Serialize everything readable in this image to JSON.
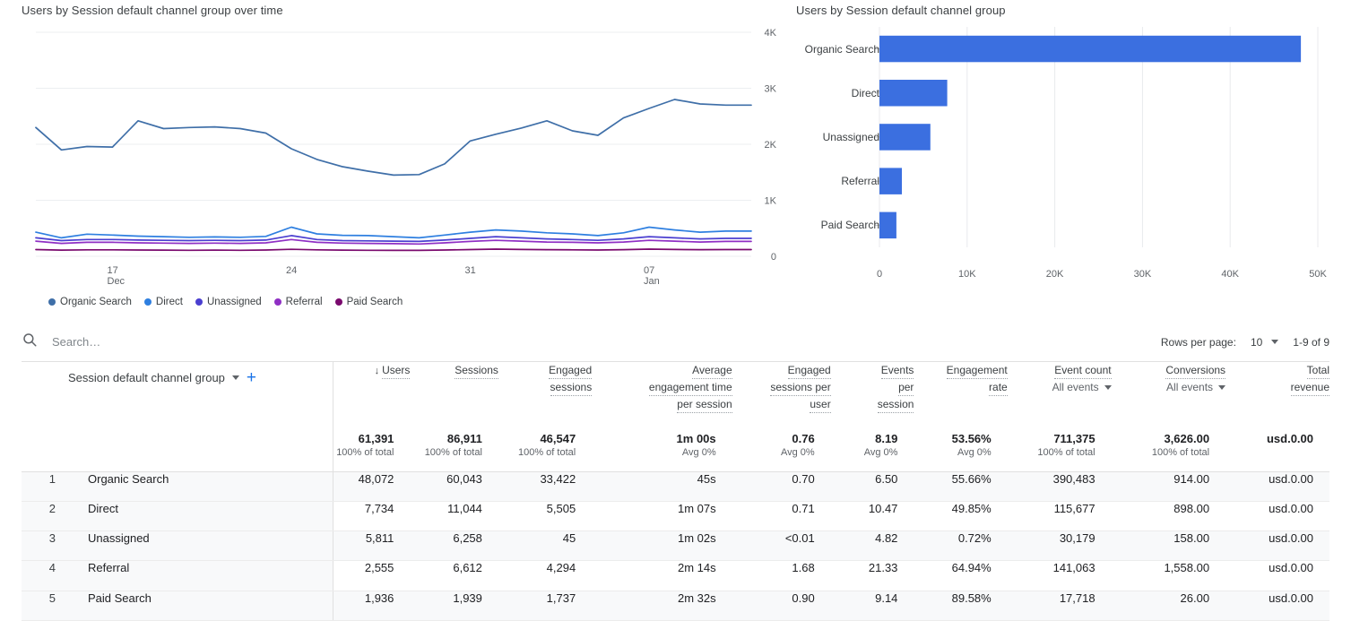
{
  "line_card": {
    "title": "Users by Session default channel group over time",
    "legend": [
      {
        "label": "Organic Search",
        "color": "#3f6fa8"
      },
      {
        "label": "Direct",
        "color": "#2e7fe0"
      },
      {
        "label": "Unassigned",
        "color": "#4b3fd0"
      },
      {
        "label": "Referral",
        "color": "#8f2fc4"
      },
      {
        "label": "Paid Search",
        "color": "#7a0a6e"
      }
    ]
  },
  "bar_card": {
    "title": "Users by Session default channel group"
  },
  "toolbar": {
    "search_placeholder": "Search…",
    "search_value": "",
    "search_icon": "search-icon",
    "rows_per_page_label": "Rows per page:",
    "rows_per_page_value": "10",
    "range_label": "1-9 of 9"
  },
  "table": {
    "dimension_header": "Session default channel group",
    "add_label": "+",
    "columns": [
      {
        "title_lines": [
          "Users"
        ],
        "sorted": true,
        "sub": null
      },
      {
        "title_lines": [
          "Sessions"
        ],
        "sorted": false,
        "sub": null
      },
      {
        "title_lines": [
          "Engaged",
          "sessions"
        ],
        "sorted": false,
        "sub": null
      },
      {
        "title_lines": [
          "Average",
          "engagement time",
          "per session"
        ],
        "sorted": false,
        "sub": null
      },
      {
        "title_lines": [
          "Engaged",
          "sessions per",
          "user"
        ],
        "sorted": false,
        "sub": null
      },
      {
        "title_lines": [
          "Events",
          "per",
          "session"
        ],
        "sorted": false,
        "sub": null
      },
      {
        "title_lines": [
          "Engagement",
          "rate"
        ],
        "sorted": false,
        "sub": null
      },
      {
        "title_lines": [
          "Event count"
        ],
        "sorted": false,
        "sub": "All events"
      },
      {
        "title_lines": [
          "Conversions"
        ],
        "sorted": false,
        "sub": "All events"
      },
      {
        "title_lines": [
          "Total",
          "revenue"
        ],
        "sorted": false,
        "sub": null
      }
    ],
    "totals": [
      {
        "main": "61,391",
        "sub": "100% of total"
      },
      {
        "main": "86,911",
        "sub": "100% of total"
      },
      {
        "main": "46,547",
        "sub": "100% of total"
      },
      {
        "main": "1m 00s",
        "sub": "Avg 0%"
      },
      {
        "main": "0.76",
        "sub": "Avg 0%"
      },
      {
        "main": "8.19",
        "sub": "Avg 0%"
      },
      {
        "main": "53.56%",
        "sub": "Avg 0%"
      },
      {
        "main": "711,375",
        "sub": "100% of total"
      },
      {
        "main": "3,626.00",
        "sub": "100% of total"
      },
      {
        "main": "usd.0.00",
        "sub": ""
      }
    ],
    "rows": [
      {
        "num": "1",
        "name": "Organic Search",
        "values": [
          "48,072",
          "60,043",
          "33,422",
          "45s",
          "0.70",
          "6.50",
          "55.66%",
          "390,483",
          "914.00",
          "usd.0.00"
        ]
      },
      {
        "num": "2",
        "name": "Direct",
        "values": [
          "7,734",
          "11,044",
          "5,505",
          "1m 07s",
          "0.71",
          "10.47",
          "49.85%",
          "115,677",
          "898.00",
          "usd.0.00"
        ]
      },
      {
        "num": "3",
        "name": "Unassigned",
        "values": [
          "5,811",
          "6,258",
          "45",
          "1m 02s",
          "<0.01",
          "4.82",
          "0.72%",
          "30,179",
          "158.00",
          "usd.0.00"
        ]
      },
      {
        "num": "4",
        "name": "Referral",
        "values": [
          "2,555",
          "6,612",
          "4,294",
          "2m 14s",
          "1.68",
          "21.33",
          "64.94%",
          "141,063",
          "1,558.00",
          "usd.0.00"
        ]
      },
      {
        "num": "5",
        "name": "Paid Search",
        "values": [
          "1,936",
          "1,939",
          "1,737",
          "2m 32s",
          "0.90",
          "9.14",
          "89.58%",
          "17,718",
          "26.00",
          "usd.0.00"
        ]
      }
    ]
  },
  "chart_data": [
    {
      "type": "line",
      "title": "Users by Session default channel group over time",
      "xlabel": "",
      "ylabel": "",
      "ylim": [
        0,
        4000
      ],
      "yticks": [
        0,
        1000,
        2000,
        3000,
        4000
      ],
      "ytick_labels": [
        "0",
        "1K",
        "2K",
        "3K",
        "4K"
      ],
      "grid": true,
      "legend_position": "bottom-left",
      "x_tick_labels": [
        {
          "day": "17",
          "month": "Dec"
        },
        {
          "day": "24",
          "month": ""
        },
        {
          "day": "31",
          "month": ""
        },
        {
          "day": "07",
          "month": "Jan"
        }
      ],
      "x": [
        "Dec 14",
        "Dec 15",
        "Dec 16",
        "Dec 17",
        "Dec 18",
        "Dec 19",
        "Dec 20",
        "Dec 21",
        "Dec 22",
        "Dec 23",
        "Dec 24",
        "Dec 25",
        "Dec 26",
        "Dec 27",
        "Dec 28",
        "Dec 29",
        "Dec 30",
        "Dec 31",
        "Jan 01",
        "Jan 02",
        "Jan 03",
        "Jan 04",
        "Jan 05",
        "Jan 06",
        "Jan 07",
        "Jan 08",
        "Jan 09",
        "Jan 10",
        "Jan 11"
      ],
      "series": [
        {
          "name": "Organic Search",
          "color": "#3f6fa8",
          "values": [
            2300,
            1900,
            1960,
            1950,
            2420,
            2280,
            2300,
            2310,
            2280,
            2200,
            1920,
            1730,
            1600,
            1520,
            1450,
            1460,
            1650,
            2060,
            2180,
            2290,
            2420,
            2240,
            2160,
            2470,
            2640,
            2800,
            2720,
            2700,
            2700
          ]
        },
        {
          "name": "Direct",
          "color": "#2e7fe0",
          "values": [
            430,
            330,
            395,
            380,
            360,
            350,
            340,
            345,
            340,
            355,
            520,
            400,
            375,
            370,
            350,
            330,
            380,
            430,
            470,
            450,
            420,
            400,
            370,
            420,
            520,
            470,
            430,
            450,
            450
          ]
        },
        {
          "name": "Unassigned",
          "color": "#4b3fd0",
          "values": [
            330,
            280,
            300,
            300,
            290,
            285,
            280,
            285,
            280,
            290,
            370,
            300,
            280,
            275,
            270,
            265,
            290,
            320,
            350,
            330,
            310,
            300,
            285,
            310,
            350,
            330,
            310,
            320,
            320
          ]
        },
        {
          "name": "Referral",
          "color": "#8f2fc4",
          "values": [
            270,
            230,
            250,
            250,
            240,
            235,
            230,
            235,
            230,
            240,
            300,
            250,
            235,
            230,
            225,
            220,
            240,
            265,
            285,
            270,
            255,
            250,
            240,
            255,
            285,
            270,
            255,
            265,
            265
          ]
        },
        {
          "name": "Paid Search",
          "color": "#7a0a6e",
          "values": [
            120,
            110,
            115,
            115,
            112,
            110,
            108,
            110,
            108,
            112,
            125,
            115,
            110,
            108,
            106,
            105,
            112,
            120,
            128,
            122,
            118,
            115,
            112,
            118,
            128,
            122,
            118,
            120,
            120
          ]
        }
      ]
    },
    {
      "type": "bar",
      "orientation": "horizontal",
      "title": "Users by Session default channel group",
      "xlabel": "",
      "ylabel": "",
      "xlim": [
        0,
        50000
      ],
      "xticks": [
        0,
        10000,
        20000,
        30000,
        40000,
        50000
      ],
      "xtick_labels": [
        "0",
        "10K",
        "20K",
        "30K",
        "40K",
        "50K"
      ],
      "grid": true,
      "bar_color": "#3b6fe0",
      "categories": [
        "Organic Search",
        "Direct",
        "Unassigned",
        "Referral",
        "Paid Search"
      ],
      "values": [
        48072,
        7734,
        5811,
        2555,
        1936
      ]
    }
  ]
}
